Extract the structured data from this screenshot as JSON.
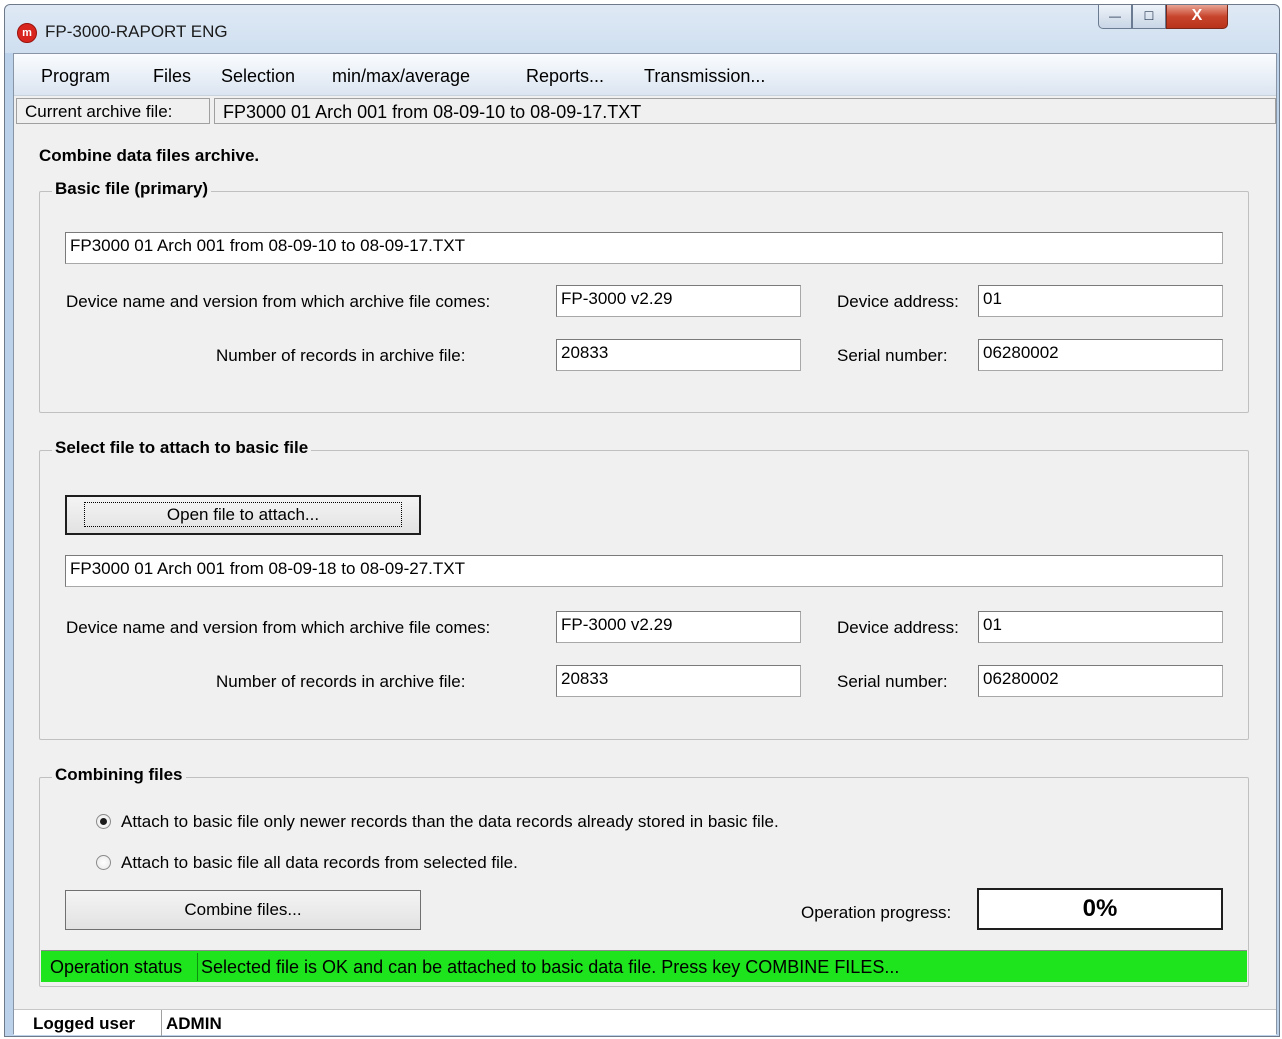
{
  "window": {
    "title": "FP-3000-RAPORT ENG",
    "app_icon_letter": "m",
    "min_glyph": "—",
    "max_glyph": "☐",
    "close_glyph": "X"
  },
  "menu": [
    "Program",
    "Files",
    "Selection",
    "min/max/average",
    "Reports...",
    "Transmission..."
  ],
  "archive": {
    "label": "Current archive file:",
    "value": "FP3000 01 Arch 001 from 08-09-10 to 08-09-17.TXT"
  },
  "heading": "Combine data files archive.",
  "basic": {
    "title": "Basic file (primary)",
    "filename": "FP3000 01 Arch 001 from 08-09-10 to 08-09-17.TXT",
    "device_name_label": "Device name and version from which archive file comes:",
    "device_name": "FP-3000 v2.29",
    "device_address_label": "Device address:",
    "device_address": "01",
    "records_label": "Number of records in archive file:",
    "records": "20833",
    "serial_label": "Serial number:",
    "serial": "06280002"
  },
  "attach": {
    "title": "Select file to attach to basic file",
    "open_button": "Open file to attach...",
    "filename": "FP3000 01 Arch 001 from 08-09-18 to 08-09-27.TXT",
    "device_name_label": "Device name and version from which archive file comes:",
    "device_name": "FP-3000 v2.29",
    "device_address_label": "Device address:",
    "device_address": "01",
    "records_label": "Number of records in archive file:",
    "records": "20833",
    "serial_label": "Serial number:",
    "serial": "06280002"
  },
  "combine": {
    "title": "Combining files",
    "option_newer": "Attach to basic file only newer records than the data records already stored in basic file.",
    "option_all": "Attach to basic file all data records from selected file.",
    "selected_option": "newer",
    "combine_button": "Combine files...",
    "progress_label": "Operation progress:",
    "progress_value": "0%"
  },
  "status": {
    "label": "Operation status",
    "message": "Selected file is OK and can be attached to basic data file. Press key COMBINE FILES...",
    "color": "#1de41d"
  },
  "user": {
    "label": "Logged user",
    "value": "ADMIN"
  }
}
